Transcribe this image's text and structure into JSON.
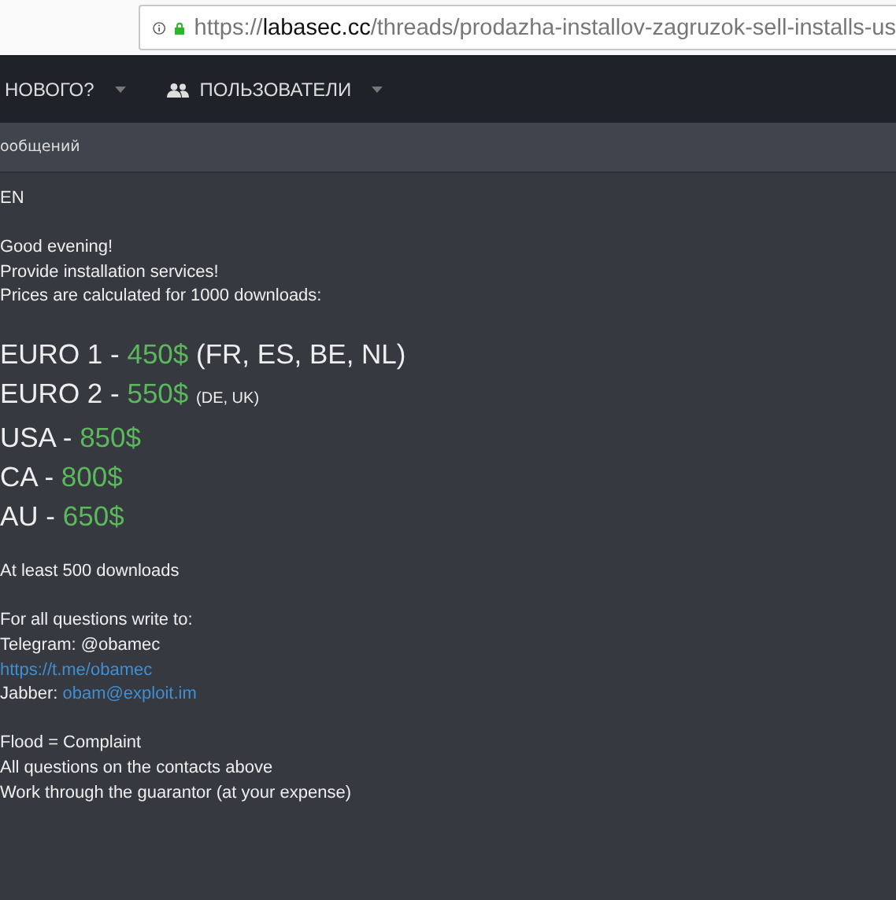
{
  "address_bar": {
    "scheme": "https://",
    "host": "labasec.cc",
    "path": "/threads/prodazha-installov-zagruzok-sell-installs-us"
  },
  "nav": {
    "items": [
      {
        "label": "НОВОГО?",
        "icon": false
      },
      {
        "label": "ПОЛЬЗОВАТЕЛИ",
        "icon": true
      }
    ]
  },
  "sub_bar": {
    "text": "ообщений"
  },
  "post": {
    "language": "EN",
    "intro": [
      "Good evening!",
      "Provide installation services!",
      "Prices are calculated for 1000 downloads:"
    ],
    "prices": [
      {
        "region": "EURO 1 - ",
        "price": "450$",
        "note": "(FR, ES, BE, NL)",
        "kind": "large"
      },
      {
        "region": "EURO 2 - ",
        "price": "550$",
        "note": "(DE, UK)",
        "kind": "small"
      },
      {
        "region": "USA - ",
        "price": "850$"
      },
      {
        "region": "CA - ",
        "price": "800$"
      },
      {
        "region": "AU - ",
        "price": "650$"
      }
    ],
    "minimum": "At least 500 downloads",
    "contacts_heading": "For all questions write to:",
    "telegram": "Telegram: @obamec",
    "telegram_link": "https://t.me/obamec",
    "jabber_label": "Jabber: ",
    "jabber_link": "obam@exploit.im",
    "rules": [
      "Flood = Complaint",
      "All questions on the contacts above",
      "Work through the guarantor (at your expense)"
    ]
  }
}
